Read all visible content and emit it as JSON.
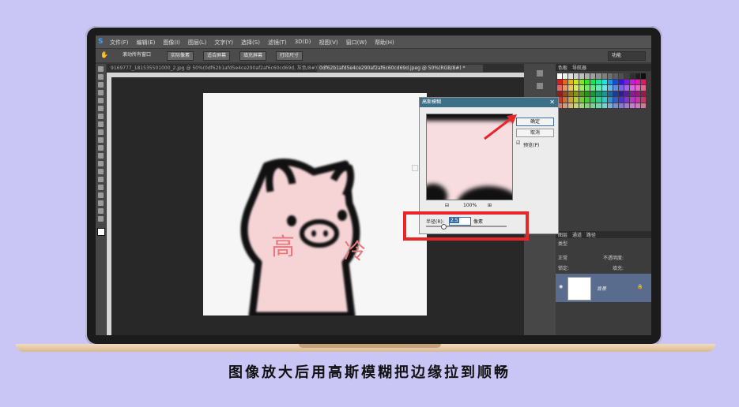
{
  "caption": "图像放大后用高斯模糊把边缘拉到顺畅",
  "photoshop": {
    "logo": "S",
    "menus": [
      "文件(F)",
      "编辑(E)",
      "图像(I)",
      "图层(L)",
      "文字(Y)",
      "选择(S)",
      "滤镜(T)",
      "3D(D)",
      "视图(V)",
      "窗口(W)",
      "帮助(H)"
    ],
    "options": {
      "scroll_all": "滚动所有窗口",
      "actual_pixels": "实际像素",
      "fit_screen": "适合屏幕",
      "fill_screen": "填充屏幕",
      "print_size": "打印尺寸",
      "workspace": "功能"
    },
    "tabs": [
      "9169777_181535501000_2.jpg @ 50%(0df62b1afd5e4ce290af2af6c60cd69d, 灰色/8#) *",
      "0df62b1afd5e4ce290af2af6c60cd69d.jpeg @ 50%(RGB/8#) *"
    ],
    "panels": {
      "swatch_tabs": [
        "色板",
        "导航器"
      ],
      "layer_tabs": [
        "图层",
        "通道",
        "路径"
      ],
      "kind": "类型",
      "blend_mode": "正常",
      "opacity_label": "不透明度:",
      "lock_label": "锁定:",
      "fill_label": "填充:",
      "layer_name": "背景"
    },
    "artwork": {
      "text_left": "高",
      "text_right": "冷"
    },
    "dialog": {
      "title": "高斯模糊",
      "ok": "确定",
      "cancel": "取消",
      "preview_label": "预览(P)",
      "zoom": "100%",
      "radius_label": "半径(R):",
      "radius_value": "2.5",
      "unit": "像素"
    }
  },
  "colors": {
    "accent_red": "#e8262a",
    "pig_pink": "#f6d4d6"
  }
}
